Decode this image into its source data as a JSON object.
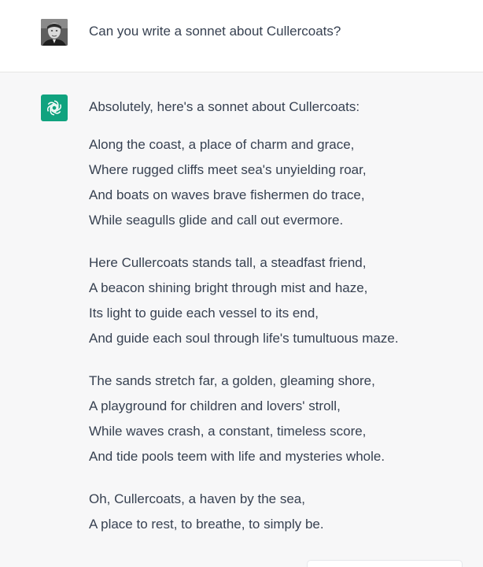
{
  "user_message": {
    "avatar": "user-photo-avatar",
    "text": "Can you write a sonnet about Cullercoats?"
  },
  "assistant_message": {
    "avatar_icon": "openai-logo-icon",
    "accent_color": "#10a37f",
    "intro": "Absolutely, here's a sonnet about Cullercoats:",
    "stanzas": [
      {
        "lines": [
          "Along the coast, a place of charm and grace,",
          "Where rugged cliffs meet sea's unyielding roar,",
          "And boats on waves brave fishermen do trace,",
          "While seagulls glide and call out evermore."
        ]
      },
      {
        "lines": [
          "Here Cullercoats stands tall, a steadfast friend,",
          "A beacon shining bright through mist and haze,",
          "Its light to guide each vessel to its end,",
          "And guide each soul through life's tumultuous maze."
        ]
      },
      {
        "lines": [
          "The sands stretch far, a golden, gleaming shore,",
          "A playground for children and lovers' stroll,",
          "While waves crash, a constant, timeless score,",
          "And tide pools teem with life and mysteries whole."
        ]
      },
      {
        "lines": [
          "Oh, Cullercoats, a haven by the sea,",
          "A place to rest, to breathe, to simply be."
        ]
      }
    ]
  }
}
